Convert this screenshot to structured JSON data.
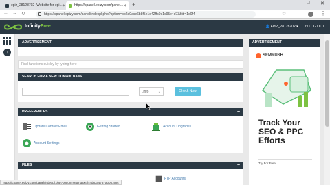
{
  "browser": {
    "tabs": [
      {
        "label": "epiz_28128702 (Website for epi..."
      },
      {
        "label": "https://cpanel.epizy.com/panel..."
      }
    ],
    "new_tab": "+",
    "window_controls": {
      "minimize": "–",
      "maximize": "□",
      "close": "✕"
    },
    "url": "https://cpanel.epizy.com/panel/indexpl.php?option=pb2a0ace6b8f5e1d42ffc9e1c95e4d73&ttl=1e0f4"
  },
  "app": {
    "brand_main": "Infinity",
    "brand_accent": "Free",
    "user": "EPIZ_28128702",
    "logout": "LOG OUT"
  },
  "panels": {
    "advertisement_top": "ADVERTISEMENT",
    "search_placeholder": "Find functions quickly by typing here",
    "domain_search_title": "SEARCH FOR A NEW DOMAIN NAME",
    "tld_selected": ".info",
    "check_button": "Check Now",
    "preferences_title": "PREFERENCES",
    "preferences_toggle": "−",
    "preferences_items": [
      {
        "label": "Update Contact Email",
        "icon": "contact-email-icon"
      },
      {
        "label": "Getting Started",
        "icon": "getting-started-icon"
      },
      {
        "label": "Account Upgrades",
        "icon": "account-upgrades-icon"
      },
      {
        "label": "Account Settings",
        "icon": "account-settings-icon"
      }
    ],
    "files_title": "FILES",
    "files_toggle": "−",
    "files_item_ftp": "FTP Accounts"
  },
  "ad": {
    "header": "ADVERTISEMENT",
    "brand": "SEMRUSH",
    "headline": "Track Your SEO & PPC Efforts",
    "cta": "Try For Free"
  },
  "status_url": "https://cpanel.epizy.com/panel/indexpl.php?option=settings&ttl=4d83a4737a0051e8c",
  "colors": {
    "header_bg": "#2b3944",
    "accent_green": "#7dc242",
    "button_blue": "#5bc0de",
    "link_blue": "#4a7fb0",
    "semrush_orange": "#ff642d"
  }
}
